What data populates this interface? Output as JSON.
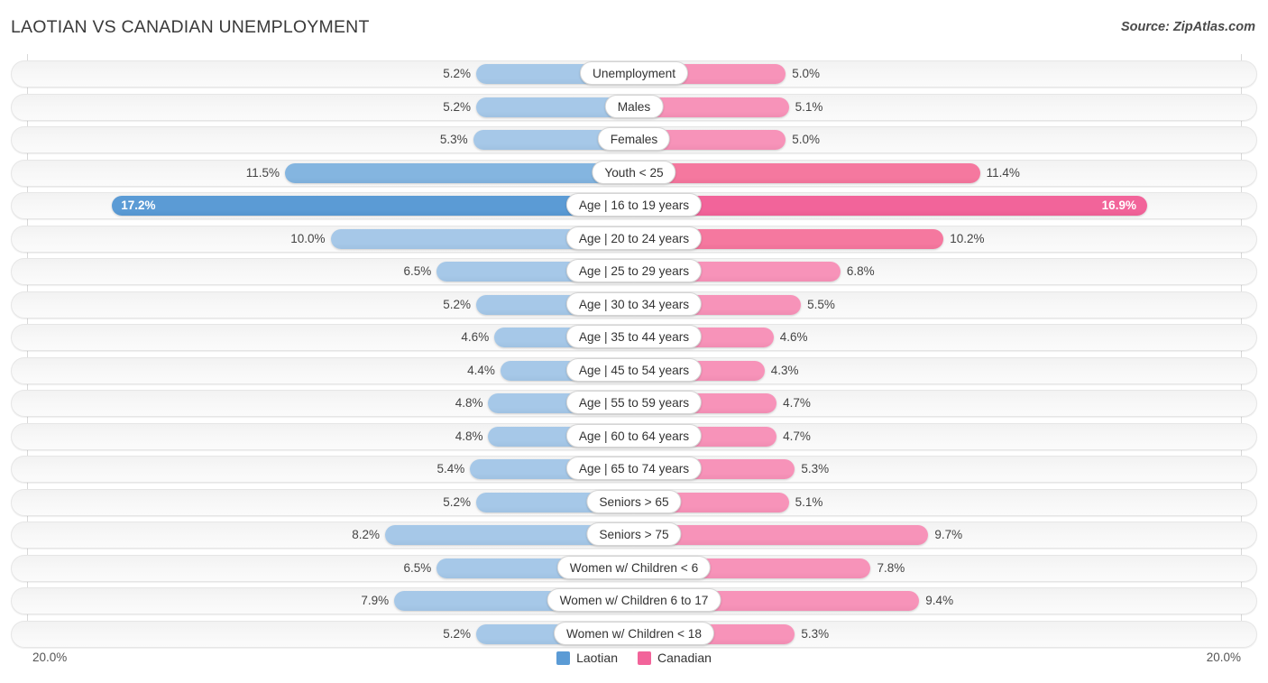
{
  "header": {
    "title": "LAOTIAN VS CANADIAN UNEMPLOYMENT",
    "source": "Source: ZipAtlas.com"
  },
  "legend": {
    "left_label": "Laotian",
    "right_label": "Canadian",
    "left_color": "#5b9bd5",
    "right_color": "#f2649a"
  },
  "axis": {
    "left_end": "20.0%",
    "right_end": "20.0%",
    "max": 20.0
  },
  "colors": {
    "left_light": "#a6c8e8",
    "left_dark": "#5b9bd5",
    "right_light": "#f793b9",
    "right_dark": "#f2649a",
    "track": "#f4f4f4",
    "gridline": "#d8d8d8"
  },
  "chart_data": {
    "type": "bar",
    "title": "LAOTIAN VS CANADIAN UNEMPLOYMENT",
    "subtitle": "",
    "xlabel": "",
    "ylabel": "",
    "orientation": "horizontal-diverging",
    "xlim": [
      20.0,
      20.0
    ],
    "grid": true,
    "legend_position": "bottom-center",
    "categories": [
      "Unemployment",
      "Males",
      "Females",
      "Youth < 25",
      "Age | 16 to 19 years",
      "Age | 20 to 24 years",
      "Age | 25 to 29 years",
      "Age | 30 to 34 years",
      "Age | 35 to 44 years",
      "Age | 45 to 54 years",
      "Age | 55 to 59 years",
      "Age | 60 to 64 years",
      "Age | 65 to 74 years",
      "Seniors > 65",
      "Seniors > 75",
      "Women w/ Children < 6",
      "Women w/ Children 6 to 17",
      "Women w/ Children < 18"
    ],
    "series": [
      {
        "name": "Laotian",
        "side": "left",
        "values": [
          5.2,
          5.2,
          5.3,
          11.5,
          17.2,
          10.0,
          6.5,
          5.2,
          4.6,
          4.4,
          4.8,
          4.8,
          5.4,
          5.2,
          8.2,
          6.5,
          7.9,
          5.2
        ],
        "labels": [
          "5.2%",
          "5.2%",
          "5.3%",
          "11.5%",
          "17.2%",
          "10.0%",
          "6.5%",
          "5.2%",
          "4.6%",
          "4.4%",
          "4.8%",
          "4.8%",
          "5.4%",
          "5.2%",
          "8.2%",
          "6.5%",
          "7.9%",
          "5.2%"
        ]
      },
      {
        "name": "Canadian",
        "side": "right",
        "values": [
          5.0,
          5.1,
          5.0,
          11.4,
          16.9,
          10.2,
          6.8,
          5.5,
          4.6,
          4.3,
          4.7,
          4.7,
          5.3,
          5.1,
          9.7,
          7.8,
          9.4,
          5.3
        ],
        "labels": [
          "5.0%",
          "5.1%",
          "5.0%",
          "11.4%",
          "16.9%",
          "10.2%",
          "6.8%",
          "5.5%",
          "4.6%",
          "4.3%",
          "4.7%",
          "4.7%",
          "5.3%",
          "5.1%",
          "9.7%",
          "7.8%",
          "9.4%",
          "5.3%"
        ]
      }
    ]
  }
}
